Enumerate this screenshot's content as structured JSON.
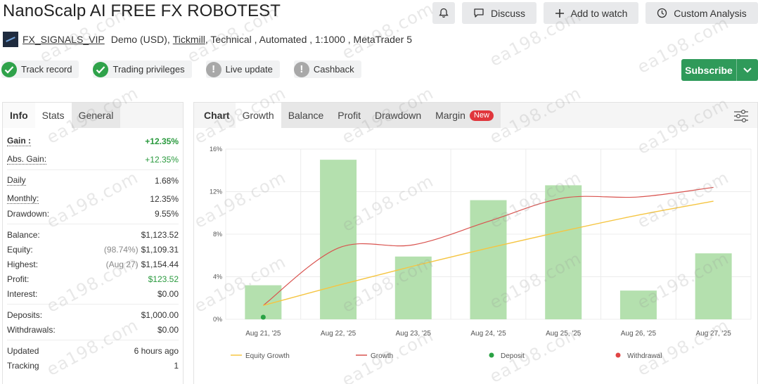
{
  "title": "NanoScalp AI FREE FX ROBOTEST",
  "buttons": {
    "discuss": "Discuss",
    "add_to_watch": "Add to watch",
    "custom_analysis": "Custom Analysis",
    "subscribe": "Subscribe"
  },
  "account": {
    "name": "FX_SIGNALS_VIP",
    "type": "Demo (USD),",
    "broker": "Tickmill",
    "details": ", Technical , Automated , 1:1000 , MetaTrader 5"
  },
  "badges": [
    {
      "label": "Track record",
      "status": "ok"
    },
    {
      "label": "Trading privileges",
      "status": "ok"
    },
    {
      "label": "Live update",
      "status": "warn"
    },
    {
      "label": "Cashback",
      "status": "warn"
    }
  ],
  "left_tabs": [
    "Info",
    "Stats",
    "General"
  ],
  "stats": {
    "gain": {
      "k": "Gain :",
      "v": "+12.35%"
    },
    "abs_gain": {
      "k": "Abs. Gain:",
      "v": "+12.35%"
    },
    "daily": {
      "k": "Daily",
      "v": "1.68%"
    },
    "monthly": {
      "k": "Monthly:",
      "v": "12.35%"
    },
    "drawdown": {
      "k": "Drawdown:",
      "v": "9.55%"
    },
    "balance": {
      "k": "Balance:",
      "v": "$1,123.52"
    },
    "equity": {
      "k": "Equity:",
      "pre": "(98.74%)",
      "v": "$1,109.31"
    },
    "highest": {
      "k": "Highest:",
      "pre": "(Aug 27)",
      "v": "$1,154.44"
    },
    "profit": {
      "k": "Profit:",
      "v": "$123.52"
    },
    "interest": {
      "k": "Interest:",
      "v": "$0.00"
    },
    "deposits": {
      "k": "Deposits:",
      "v": "$1,000.00"
    },
    "withdrawals": {
      "k": "Withdrawals:",
      "v": "$0.00"
    },
    "updated": {
      "k": "Updated",
      "v": "6 hours ago"
    },
    "tracking": {
      "k": "Tracking",
      "v": "1"
    }
  },
  "chart_tabs": {
    "label": "Chart",
    "items": [
      "Growth",
      "Balance",
      "Profit",
      "Drawdown",
      "Margin"
    ],
    "new_badge": "New"
  },
  "chart_data": {
    "type": "bar",
    "categories": [
      "Aug 21, '25",
      "Aug 22, '25",
      "Aug 23, '25",
      "Aug 24, '25",
      "Aug 25, '25",
      "Aug 26, '25",
      "Aug 27, '25"
    ],
    "y_ticks": [
      "0%",
      "4%",
      "8%",
      "12%",
      "16%"
    ],
    "ylim": [
      0,
      16
    ],
    "grid": true,
    "legend_position": "bottom",
    "series": [
      {
        "name": "Growth",
        "kind": "bar",
        "color": "#b4e0ae",
        "values": [
          3.2,
          15.0,
          5.9,
          11.2,
          12.6,
          2.7,
          6.2
        ]
      },
      {
        "name": "Growth",
        "kind": "line",
        "color": "#d9534f",
        "values": [
          1.3,
          6.7,
          7.0,
          9.2,
          11.4,
          11.5,
          12.4
        ]
      },
      {
        "name": "Equity Growth",
        "kind": "line",
        "color": "#f5c542",
        "values": [
          1.3,
          3.2,
          5.0,
          6.7,
          8.3,
          9.8,
          11.1
        ]
      }
    ],
    "deposit_point": {
      "category": "Aug 21, '25",
      "value": 0.2
    },
    "legend": [
      {
        "label": "Equity Growth",
        "color": "#f5c542",
        "shape": "line"
      },
      {
        "label": "Growth",
        "color": "#d9534f",
        "shape": "line"
      },
      {
        "label": "Deposit",
        "color": "#2aa244",
        "shape": "dot"
      },
      {
        "label": "Withdrawal",
        "color": "#e04545",
        "shape": "dot"
      }
    ]
  },
  "watermark": "ea198.com"
}
